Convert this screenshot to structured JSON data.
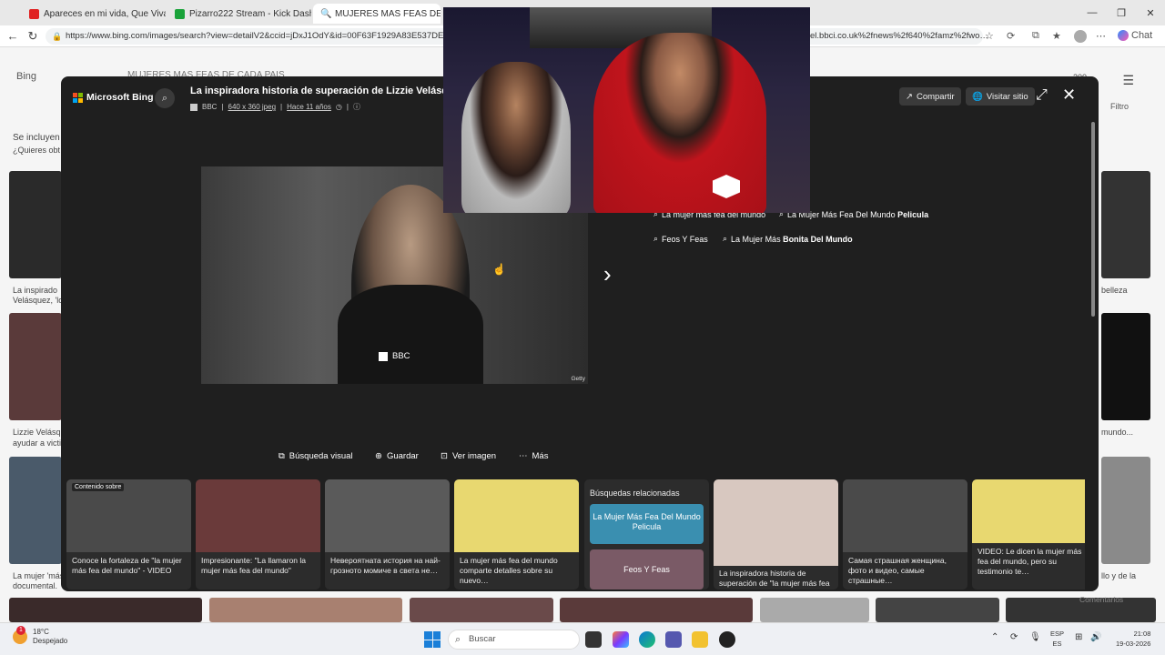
{
  "browser": {
    "tabs": [
      {
        "label": "Apareces en mi vida, Que Viva Ve",
        "color": "#e02020"
      },
      {
        "label": "Pizarro222 Stream - Kick Dashboa",
        "color": "#1aa33a"
      },
      {
        "label": "MUJERES MAS FEAS DE CADA PA",
        "color": "#4a90d9"
      }
    ],
    "url": "https://www.bing.com/images/search?view=detailV2&ccid=jDxJ1OdY&id=00F63F1929A83E537DE47",
    "url_tail": "el.bbci.co.uk%2fnews%2f640%2famz%2fwo…",
    "chat_label": "Chat"
  },
  "bing_bg": {
    "logo": "Bing",
    "search_text": "MUJERES MAS FEAS DE CADA PAIS",
    "count": "200",
    "side_texts": [
      "Se incluyen",
      "¿Quieres obt",
      "La inspirado",
      "Velásquez, 'lo",
      "Lizzie Velásq",
      "ayudar a victi",
      "La mujer 'más",
      "documental."
    ],
    "right_texts": [
      "Filtro",
      "belleza",
      "mundo...",
      "llo y de la"
    ],
    "comments": "Comentarios"
  },
  "modal": {
    "brand": "Microsoft Bing",
    "title": "La inspiradora historia de superación de Lizzie Velásquez,",
    "source": "BBC",
    "dimensions": "640 x 360 jpeg",
    "age": "Hace 11 años",
    "share_label": "Compartir",
    "visit_label": "Visitar sitio",
    "image_source_badge": "BBC",
    "image_credit": "Getty",
    "related_pills": [
      {
        "text": "La mujer más fea del mundo",
        "bold": ""
      },
      {
        "text": "La Mujer Más Fea Del Mundo ",
        "bold": "Pelicula"
      },
      {
        "text": "Feos Y Feas",
        "bold": ""
      },
      {
        "text": "La Mujer Más ",
        "bold": "Bonita Del Mundo"
      }
    ],
    "actions": [
      "Búsqueda visual",
      "Guardar",
      "Ver imagen",
      "Más"
    ],
    "cards": [
      {
        "caption": "Conoce la fortaleza de \"la mujer más fea del mundo\" - VIDEO",
        "tag": "Contenido sobre",
        "color": "#4a4a4a"
      },
      {
        "caption": "Impresionante: \"La llamaron la mujer más fea del mundo\"",
        "tag": "",
        "color": "#6a3a3a"
      },
      {
        "caption": "Невероятната история на най-грозното момиче в света не…",
        "tag": "",
        "color": "#5a5a5a"
      },
      {
        "caption": "La mujer más fea del mundo comparte detalles sobre su nuevo…",
        "tag": "",
        "color": "#e8d870"
      },
      {
        "caption": "La inspiradora historia de superación de \"la mujer más fea d…",
        "tag": "",
        "color": "#d8c8c0"
      },
      {
        "caption": "Самая страшная женщина, фото и видео, самые страшные…",
        "tag": "",
        "color": "#4a4a4a"
      },
      {
        "caption": "VIDEO: Le dicen la mujer más fea del mundo, pero su testimonio te…",
        "tag": "",
        "color": "#e8d870"
      }
    ],
    "related_searches": {
      "heading": "Búsquedas relacionadas",
      "items": [
        "La Mujer Más Fea Del Mundo Pelicula",
        "Feos Y Feas"
      ]
    }
  },
  "taskbar": {
    "temp": "18°C",
    "weather": "Despejado",
    "weather_badge": "1",
    "search_placeholder": "Buscar",
    "lang1": "ESP",
    "lang2": "ES",
    "time": "21:08",
    "date": "19-03-2026"
  }
}
